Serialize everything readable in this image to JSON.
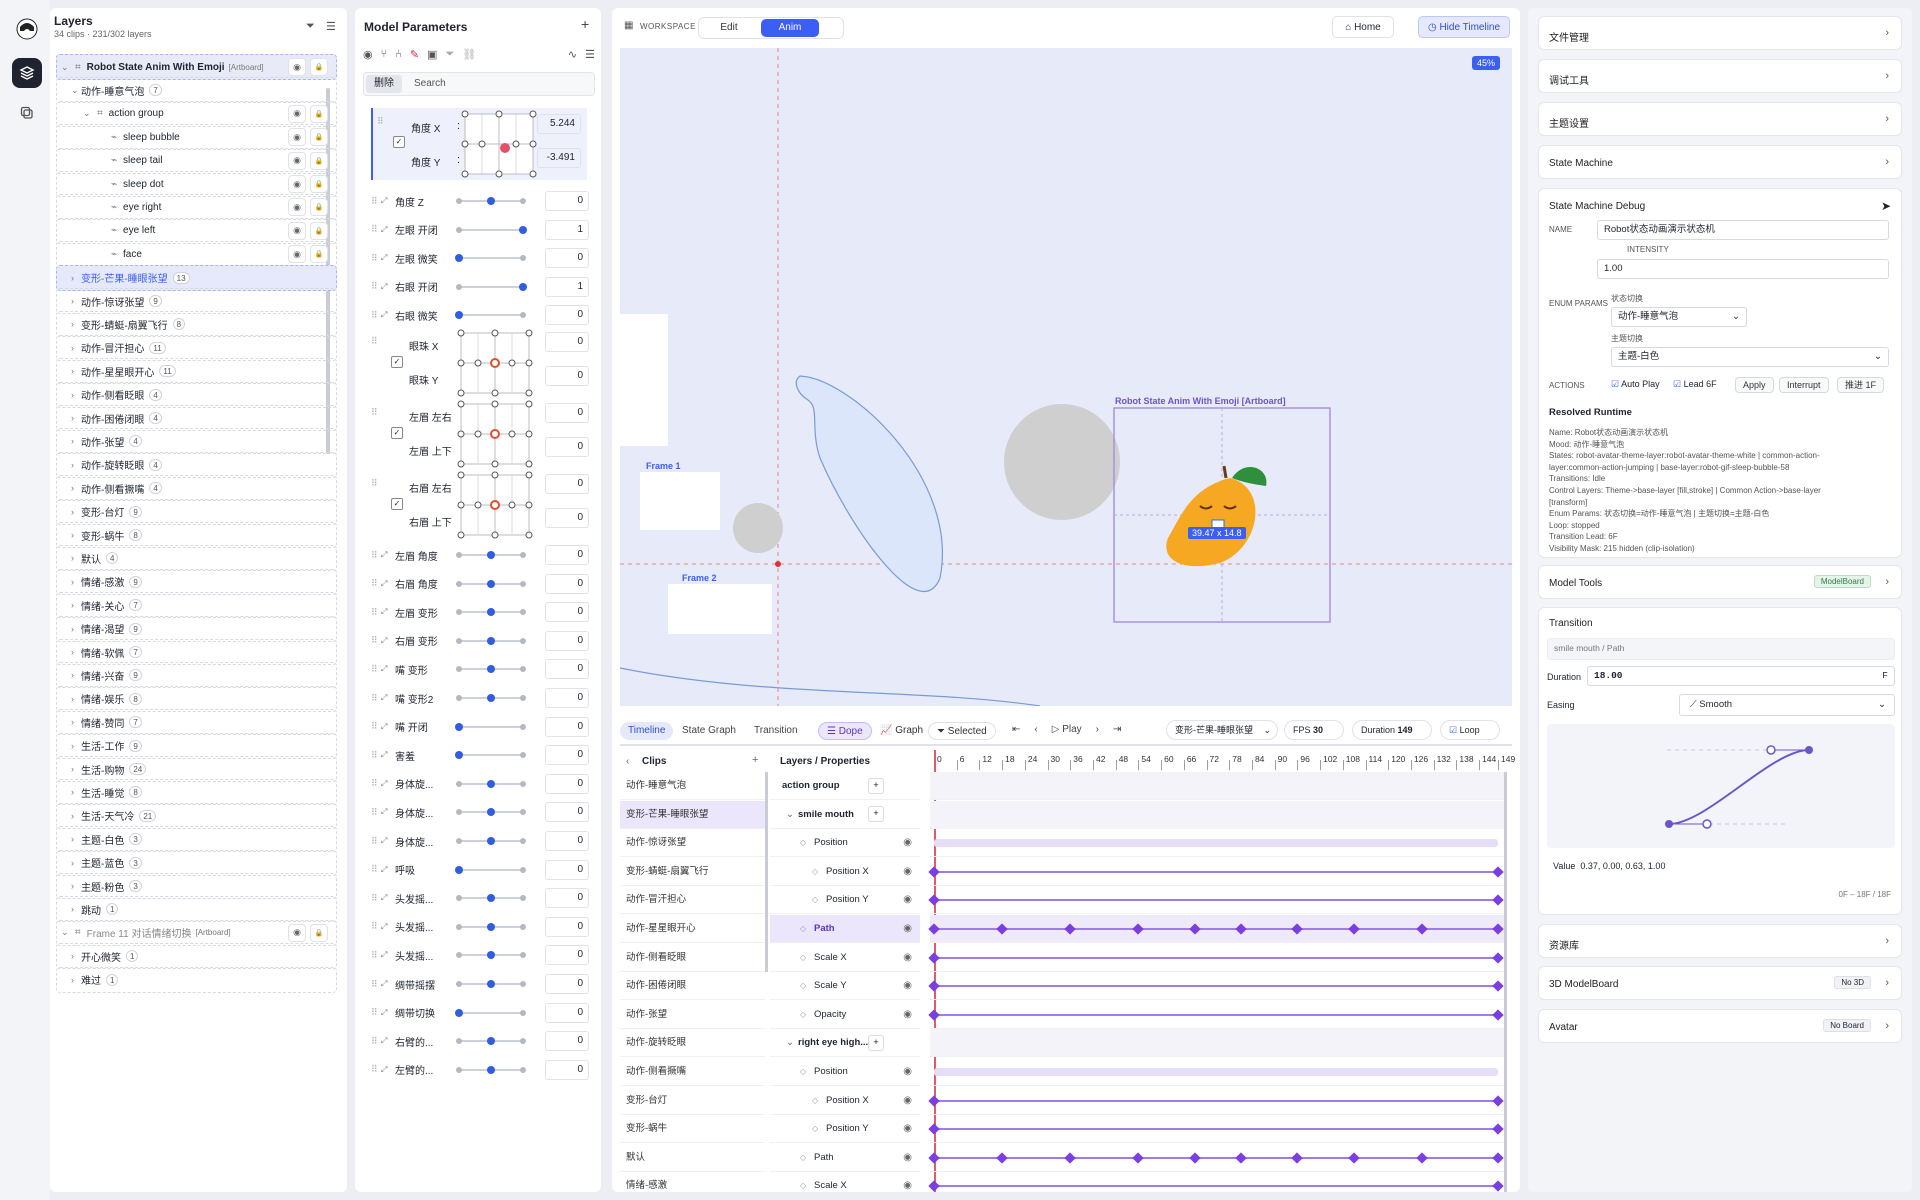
{
  "layers": {
    "title": "Layers",
    "subtitle": "34 clips · 231/302 layers",
    "artboard_name": "Robot State Anim With Emoji",
    "artboard_tag": "[Artboard]",
    "group1": {
      "label": "动作-睡意气泡",
      "count": "7"
    },
    "action_group": "action group",
    "children": [
      "sleep bubble",
      "sleep tail",
      "sleep dot",
      "eye right",
      "eye left",
      "face"
    ],
    "clips": [
      {
        "label": "变形-芒果-睡眼张望",
        "count": "13"
      },
      {
        "label": "动作-惊讶张望",
        "count": "9"
      },
      {
        "label": "变形-蜻蜓-扇翼飞行",
        "count": "8"
      },
      {
        "label": "动作-冒汗担心",
        "count": "11"
      },
      {
        "label": "动作-星星眼开心",
        "count": "11"
      },
      {
        "label": "动作-侧看眨眼",
        "count": "4"
      },
      {
        "label": "动作-困倦闭眼",
        "count": "4"
      },
      {
        "label": "动作-张望",
        "count": "4"
      },
      {
        "label": "动作-旋转眨眼",
        "count": "4"
      },
      {
        "label": "动作-侧看撅嘴",
        "count": "4"
      },
      {
        "label": "变形-台灯",
        "count": "9"
      },
      {
        "label": "变形-蜗牛",
        "count": "8"
      },
      {
        "label": "默认",
        "count": "4"
      },
      {
        "label": "情绪-感激",
        "count": "9"
      },
      {
        "label": "情绪-关心",
        "count": "7"
      },
      {
        "label": "情绪-渴望",
        "count": "9"
      },
      {
        "label": "情绪-软佩",
        "count": "7"
      },
      {
        "label": "情绪-兴奋",
        "count": "9"
      },
      {
        "label": "情绪-娱乐",
        "count": "8"
      },
      {
        "label": "情绪-赞同",
        "count": "7"
      },
      {
        "label": "生活-工作",
        "count": "9"
      },
      {
        "label": "生活-购物",
        "count": "24"
      },
      {
        "label": "生活-睡觉",
        "count": "8"
      },
      {
        "label": "生活-天气冷",
        "count": "21"
      },
      {
        "label": "主题-白色",
        "count": "3"
      },
      {
        "label": "主题-蓝色",
        "count": "3"
      },
      {
        "label": "主题-粉色",
        "count": "3"
      },
      {
        "label": "跳动",
        "count": "1"
      }
    ],
    "frame11": {
      "label": "Frame 11 对话情绪切换",
      "tag": "[Artboard]"
    },
    "frame11_children": [
      {
        "label": "开心微笑",
        "count": "1"
      },
      {
        "label": "难过",
        "count": "1"
      }
    ]
  },
  "params": {
    "title": "Model Parameters",
    "tab_delete": "删除",
    "search_placeholder": "Search",
    "angle_x": {
      "label": "角度 X",
      "value": "5.244"
    },
    "angle_y": {
      "label": "角度 Y",
      "value": "-3.491"
    },
    "sliders1": [
      {
        "label": "角度 Z",
        "value": "0",
        "level": 0.5
      },
      {
        "label": "左眼 开闭",
        "value": "1",
        "level": 1.0
      },
      {
        "label": "左眼 微笑",
        "value": "0",
        "level": 0.0
      },
      {
        "label": "右眼 开闭",
        "value": "1",
        "level": 1.0
      },
      {
        "label": "右眼 微笑",
        "value": "0",
        "level": 0.0
      }
    ],
    "pads": [
      {
        "a": "眼珠 X",
        "b": "眼珠 Y",
        "va": "0",
        "vb": "0"
      },
      {
        "a": "左眉 左右",
        "b": "左眉 上下",
        "va": "0",
        "vb": "0"
      },
      {
        "a": "右眉 左右",
        "b": "右眉 上下",
        "va": "0",
        "vb": "0"
      }
    ],
    "sliders2": [
      {
        "label": "左眉 角度",
        "value": "0",
        "level": 0.5
      },
      {
        "label": "右眉 角度",
        "value": "0",
        "level": 0.5
      },
      {
        "label": "左眉 变形",
        "value": "0",
        "level": 0.5
      },
      {
        "label": "右眉 变形",
        "value": "0",
        "level": 0.5
      },
      {
        "label": "嘴 变形",
        "value": "0",
        "level": 0.5
      },
      {
        "label": "嘴 变形2",
        "value": "0",
        "level": 0.5
      },
      {
        "label": "嘴 开闭",
        "value": "0",
        "level": 0.0
      },
      {
        "label": "害羞",
        "value": "0",
        "level": 0.0
      },
      {
        "label": "身体旋...",
        "value": "0",
        "level": 0.5
      },
      {
        "label": "身体旋...",
        "value": "0",
        "level": 0.5
      },
      {
        "label": "身体旋...",
        "value": "0",
        "level": 0.5
      },
      {
        "label": "呼吸",
        "value": "0",
        "level": 0.0
      },
      {
        "label": "头发摇...",
        "value": "0",
        "level": 0.5
      },
      {
        "label": "头发摇...",
        "value": "0",
        "level": 0.5
      },
      {
        "label": "头发摇...",
        "value": "0",
        "level": 0.5
      },
      {
        "label": "绸带摇摆",
        "value": "0",
        "level": 0.5
      },
      {
        "label": "绸带切换",
        "value": "0",
        "level": 0.0
      },
      {
        "label": "右臂的...",
        "value": "0",
        "level": 0.5
      },
      {
        "label": "左臂的...",
        "value": "0",
        "level": 0.5
      }
    ]
  },
  "canvas": {
    "workspace": "WORKSPACE",
    "mode_edit": "Edit",
    "mode_anim": "Anim",
    "home": "Home",
    "hide_timeline": "Hide Timeline",
    "zoom": "45%",
    "frame1": "Frame 1",
    "frame2": "Frame 2",
    "artboard_label": "Robot State Anim With Emoji [Artboard]",
    "size_readout": "39.47 x 14.8"
  },
  "timeline": {
    "tabs": [
      "Timeline",
      "State Graph",
      "Transition"
    ],
    "dope": "Dope",
    "graph": "Graph",
    "selected": "Selected",
    "play": "Play",
    "clip_select": "变形-芒果-睡眼张望",
    "fps_label": "FPS",
    "fps": "30",
    "duration_label": "Duration",
    "duration": "149",
    "loop": "Loop",
    "clips_header": "Clips",
    "props_header": "Layers / Properties",
    "ticks": [
      "0",
      "6",
      "12",
      "18",
      "24",
      "30",
      "36",
      "42",
      "48",
      "54",
      "60",
      "66",
      "72",
      "78",
      "84",
      "90",
      "96",
      "102",
      "108",
      "114",
      "120",
      "126",
      "132",
      "138",
      "144",
      "149"
    ],
    "clips": [
      "动作-睡意气泡",
      "变形-芒果-睡眼张望",
      "动作-惊讶张望",
      "变形-蜻蜓-扇翼飞行",
      "动作-冒汗担心",
      "动作-星星眼开心",
      "动作-侧看眨眼",
      "动作-困倦闭眼",
      "动作-张望",
      "动作-旋转眨眼",
      "动作-侧看撅嘴",
      "变形-台灯",
      "变形-蜗牛",
      "默认",
      "情绪-感激"
    ],
    "props": [
      {
        "label": "action group",
        "kind": "group"
      },
      {
        "label": "smile mouth",
        "kind": "layer"
      },
      {
        "label": "Position",
        "kind": "prop"
      },
      {
        "label": "Position X",
        "kind": "sub"
      },
      {
        "label": "Position Y",
        "kind": "sub"
      },
      {
        "label": "Path",
        "kind": "prop",
        "active": true
      },
      {
        "label": "Scale X",
        "kind": "prop"
      },
      {
        "label": "Scale Y",
        "kind": "prop"
      },
      {
        "label": "Opacity",
        "kind": "prop"
      },
      {
        "label": "right eye high...",
        "kind": "layer"
      },
      {
        "label": "Position",
        "kind": "prop"
      },
      {
        "label": "Position X",
        "kind": "sub"
      },
      {
        "label": "Position Y",
        "kind": "sub"
      },
      {
        "label": "Path",
        "kind": "prop"
      },
      {
        "label": "Scale X",
        "kind": "prop"
      }
    ],
    "keyframes": {
      "two_ends": [
        0,
        149
      ],
      "path": [
        0,
        18,
        36,
        54,
        69,
        81,
        96,
        111,
        129,
        149
      ]
    }
  },
  "right": {
    "file": "文件管理",
    "debug_tools": "调试工具",
    "theme": "主题设置",
    "state_machine": "State Machine",
    "smd_title": "State Machine Debug",
    "name_label": "NAME",
    "name_value": "Robot状态动画演示状态机",
    "intensity_label": "INTENSITY",
    "intensity_value": "1.00",
    "enum_label": "ENUM PARAMS",
    "enum1_label": "状态切换",
    "enum1_value": "动作-睡意气泡",
    "enum2_label": "主题切换",
    "enum2_value": "主题-白色",
    "actions_label": "ACTIONS",
    "auto_play": "Auto Play",
    "lead": "Lead 6F",
    "apply": "Apply",
    "interrupt": "Interrupt",
    "advance": "推进 1F",
    "resolved_title": "Resolved Runtime",
    "resolved_lines": [
      "Name: Robot状态动画演示状态机",
      "Mood: 动作-睡意气泡",
      "States: robot-avatar-theme-layer:robot-avatar-theme-white | common-action-",
      "layer:common-action-jumping | base-layer:robot-gif-sleep-bubble-58",
      "Transitions: Idle",
      "Control Layers: Theme->base-layer [fill,stroke] | Common Action->base-layer",
      "[transform]",
      "Enum Params: 状态切换=动作-睡意气泡 | 主题切换=主题-白色",
      "Loop: stopped",
      "Transition Lead: 6F",
      "Visibility Mask: 215 hidden (clip-isolation)"
    ],
    "model_tools": "Model Tools",
    "model_tools_badge": "ModelBoard",
    "transition_title": "Transition",
    "transition_target": "smile mouth / Path",
    "duration_label": "Duration",
    "duration_value": "18.00",
    "duration_unit": "F",
    "easing_label": "Easing",
    "easing_value": "Smooth",
    "value_label": "Value",
    "value_value": "0.37, 0.00, 0.63, 1.00",
    "range_note": "0F – 18F / 18F",
    "resources": "资源库",
    "modelboard3d": "3D ModelBoard",
    "modelboard3d_badge": "No 3D",
    "avatar": "Avatar",
    "avatar_badge": "No Board"
  },
  "colors": {
    "accent": "#3b5ef5",
    "keyframe": "#7b3fe0",
    "artboard": "#a58de0",
    "mango": "#f6a823"
  }
}
